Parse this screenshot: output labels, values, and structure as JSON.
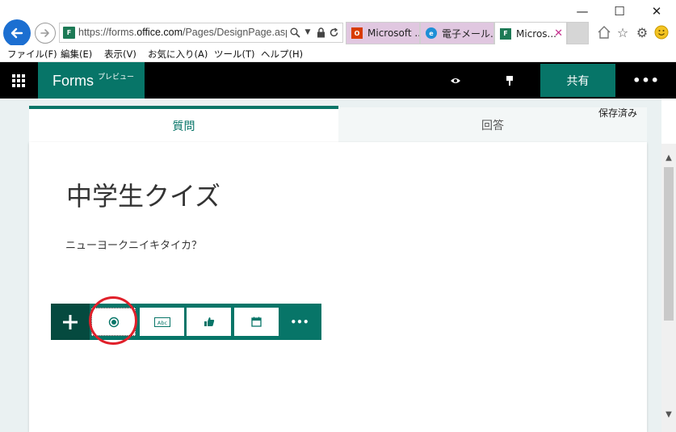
{
  "browser": {
    "url_prefix": "https://forms.",
    "url_domain": "office.com",
    "url_path": "/Pages/DesignPage.aspx",
    "tabs": [
      {
        "label": "Microsoft ..."
      },
      {
        "label": "電子メール..."
      },
      {
        "label": "Micros..."
      }
    ],
    "menu": [
      "ファイル(F)",
      "編集(E)",
      "表示(V)",
      "お気に入り(A)",
      "ツール(T)",
      "ヘルプ(H)"
    ]
  },
  "header": {
    "app_name": "Forms",
    "app_badge": "プレビュー",
    "share_label": "共有",
    "more_label": "•••"
  },
  "tabs": {
    "questions": "質問",
    "responses": "回答",
    "save_status": "保存済み"
  },
  "form": {
    "title": "中学生クイズ",
    "description": "ニューヨークニイキタイカ？"
  },
  "toolbar": {
    "add_label": "+",
    "text_icon_label": "Abc",
    "more_label": "•••"
  },
  "colors": {
    "accent": "#077568",
    "accent_dark": "#054a3f",
    "highlight": "#e0202a",
    "tab_inactive": "#e0c7e0",
    "background": "#eaf1f2"
  }
}
